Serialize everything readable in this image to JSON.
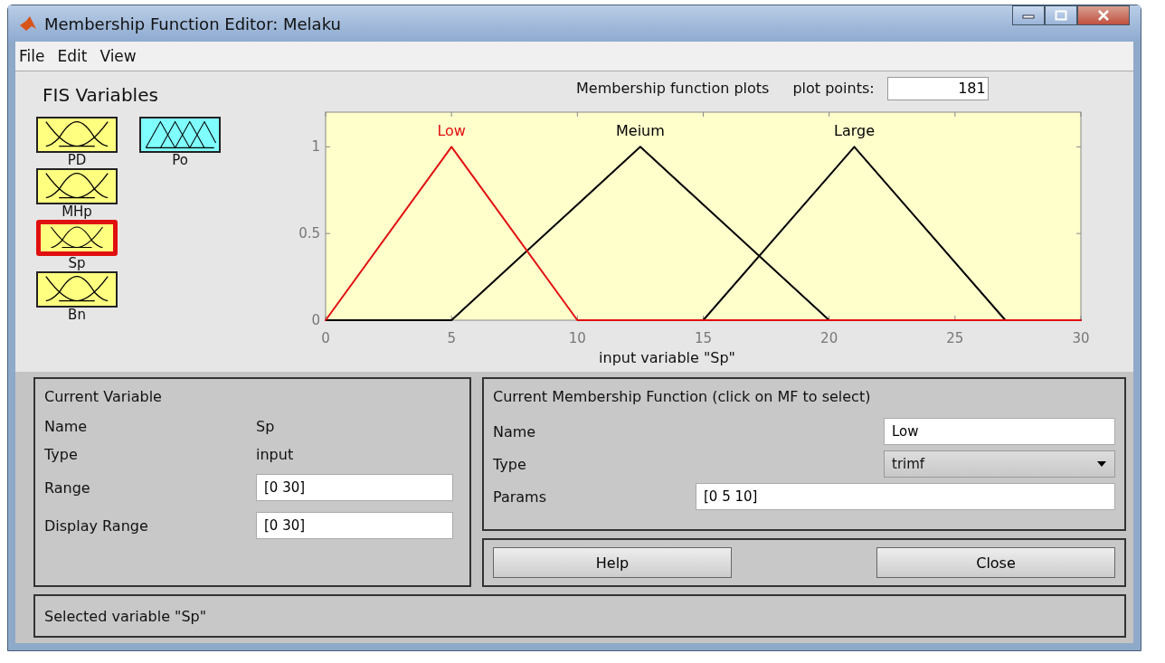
{
  "window": {
    "title": "Membership Function Editor: Melaku"
  },
  "menu": [
    "File",
    "Edit",
    "View"
  ],
  "fis_variables": {
    "title": "FIS Variables",
    "items": [
      {
        "label": "PD",
        "kind": "input",
        "selected": false
      },
      {
        "label": "Po",
        "kind": "output",
        "selected": false
      },
      {
        "label": "MHp",
        "kind": "input",
        "selected": false
      },
      {
        "label": "Sp",
        "kind": "input",
        "selected": true
      },
      {
        "label": "Bn",
        "kind": "input",
        "selected": false
      }
    ]
  },
  "plot": {
    "plot_points_label": "plot points:",
    "plot_points": "181",
    "chart_data": {
      "type": "line",
      "title": "Membership function plots",
      "xlabel": "input variable \"Sp\"",
      "x": [
        0,
        5,
        10,
        12.5,
        15,
        20,
        21,
        27,
        30
      ],
      "series": [
        {
          "name": "Low",
          "color": "#e01010",
          "values": [
            0,
            1,
            0,
            0,
            0,
            0,
            0,
            0,
            0
          ]
        },
        {
          "name": "Meium",
          "color": "#000000",
          "values": [
            0,
            0,
            0.667,
            1,
            0.667,
            0,
            null,
            null,
            null
          ]
        },
        {
          "name": "Large",
          "color": "#000000",
          "values": [
            null,
            null,
            null,
            null,
            0,
            0.833,
            1,
            0,
            0
          ]
        }
      ],
      "xlim": [
        0,
        30
      ],
      "ylim": [
        0,
        1.2
      ],
      "xticks": [
        0,
        5,
        10,
        15,
        20,
        25,
        30
      ],
      "yticks": [
        0,
        0.5,
        1
      ]
    }
  },
  "current_variable": {
    "title": "Current Variable",
    "name_label": "Name",
    "name": "Sp",
    "type_label": "Type",
    "type": "input",
    "range_label": "Range",
    "range": "[0 30]",
    "display_range_label": "Display Range",
    "display_range": "[0 30]"
  },
  "current_mf": {
    "title": "Current Membership Function (click on MF to select)",
    "name_label": "Name",
    "name": "Low",
    "type_label": "Type",
    "type": "trimf",
    "params_label": "Params",
    "params": "[0 5 10]"
  },
  "buttons": [
    {
      "label": "Help"
    },
    {
      "label": "Close"
    }
  ],
  "status": "Selected variable \"Sp\""
}
